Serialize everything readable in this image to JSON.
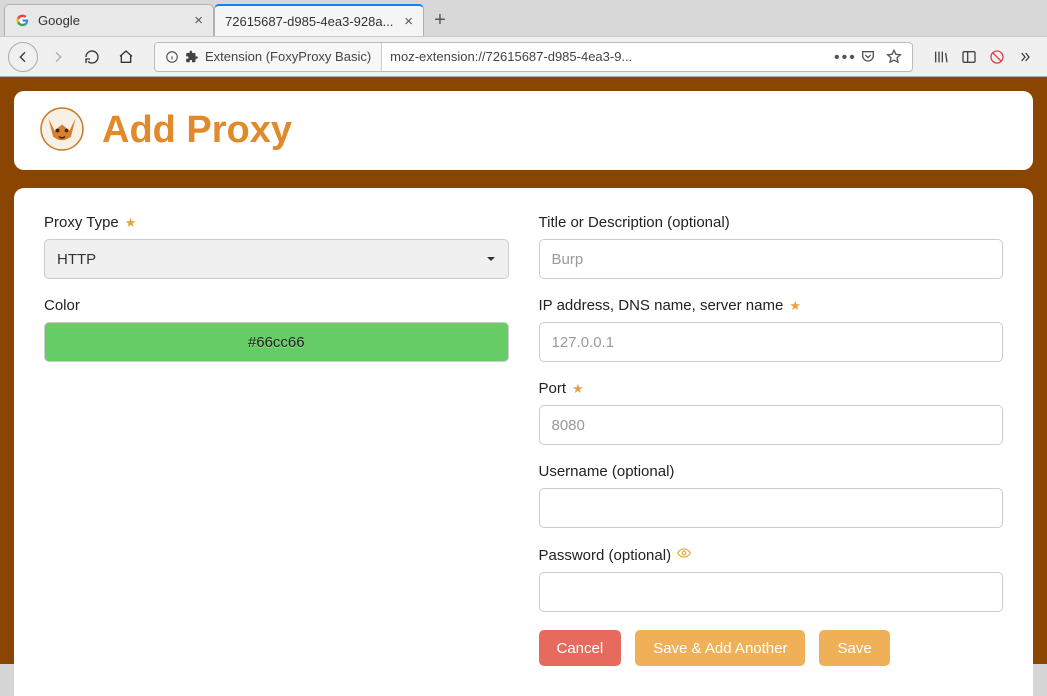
{
  "browser": {
    "tabs": [
      {
        "title": "Google"
      },
      {
        "title": "72615687-d985-4ea3-928a..."
      }
    ],
    "url_identity": "Extension (FoxyProxy Basic)",
    "url": "moz-extension://72615687-d985-4ea3-9..."
  },
  "page": {
    "title": "Add Proxy",
    "left": {
      "proxy_type_label": "Proxy Type",
      "proxy_type_value": "HTTP",
      "color_label": "Color",
      "color_value": "#66cc66"
    },
    "right": {
      "title_label": "Title or Description (optional)",
      "title_placeholder": "Burp",
      "ip_label": "IP address, DNS name, server name",
      "ip_placeholder": "127.0.0.1",
      "port_label": "Port",
      "port_placeholder": "8080",
      "username_label": "Username (optional)",
      "password_label": "Password (optional)"
    },
    "buttons": {
      "cancel": "Cancel",
      "save_add": "Save & Add Another",
      "save": "Save"
    }
  }
}
